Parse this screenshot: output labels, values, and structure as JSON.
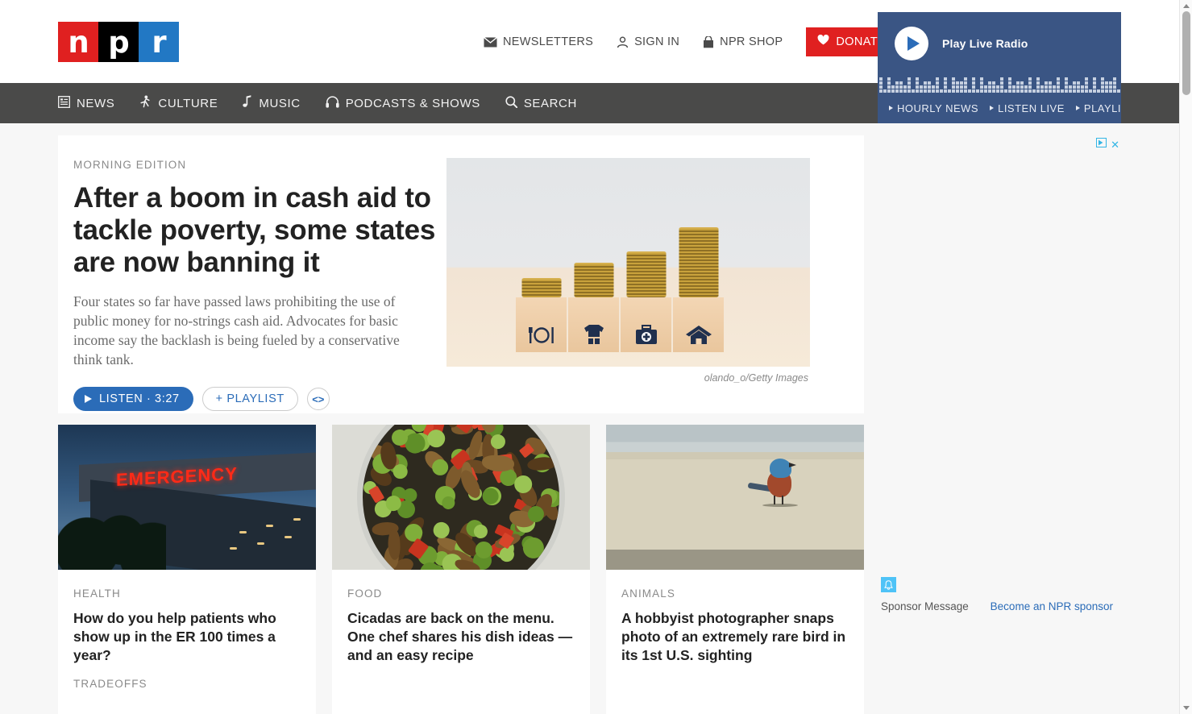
{
  "header": {
    "logo": {
      "letters": [
        "n",
        "p",
        "r"
      ],
      "colors": [
        "#e02020",
        "#000000",
        "#2278c4"
      ]
    },
    "util_nav": [
      {
        "label": "NEWSLETTERS",
        "icon": "envelope-icon"
      },
      {
        "label": "SIGN IN",
        "icon": "person-icon"
      },
      {
        "label": "NPR SHOP",
        "icon": "shopping-bag-icon"
      }
    ],
    "donate_label": "DONATE"
  },
  "mainnav": [
    {
      "label": "NEWS",
      "icon": "list-icon"
    },
    {
      "label": "CULTURE",
      "icon": "dancer-icon"
    },
    {
      "label": "MUSIC",
      "icon": "music-note-icon"
    },
    {
      "label": "PODCASTS & SHOWS",
      "icon": "headphones-icon"
    },
    {
      "label": "SEARCH",
      "icon": "search-icon"
    }
  ],
  "radio": {
    "play_label": "Play Live Radio",
    "links": [
      "HOURLY NEWS",
      "LISTEN LIVE",
      "PLAYLIST"
    ],
    "panel_color": "#3a5584"
  },
  "hero": {
    "kicker": "MORNING EDITION",
    "title": "After a boom in cash aid to tackle poverty, some states are now banning it",
    "teaser": "Four states so far have passed laws prohibiting the use of public money for no-strings cash aid. Advocates for basic income say the backlash is being fueled by a conservative think tank.",
    "listen_label": "LISTEN · 3:27",
    "playlist_label": "+ PLAYLIST",
    "embed_label": "<>",
    "credit": "olando_o/Getty Images",
    "image_alt": "Stacks of coins on wooden blocks with food, clothing, medical and housing icons"
  },
  "cards": [
    {
      "kicker": "HEALTH",
      "title": "How do you help patients who show up in the ER 100 times a year?",
      "source": "TRADEOFFS",
      "image_alt": "Hospital emergency entrance sign glowing red at dusk",
      "sign_text": "EMERGENCY"
    },
    {
      "kicker": "FOOD",
      "title": "Cicadas are back on the menu. One chef shares his dish ideas — and an easy recipe",
      "source": "",
      "image_alt": "Bowl of stir fried cicadas with edamame and red peppers"
    },
    {
      "kicker": "ANIMALS",
      "title": "A hobbyist photographer snaps photo of an extremely rare bird in its 1st U.S. sighting",
      "source": "",
      "image_alt": "Blue and rust colored bird standing on a sandy beach"
    }
  ],
  "ad": {
    "choices_icon": "adchoices-icon",
    "close_label": "✕",
    "sponsor_message": "Sponsor Message",
    "sponsor_link": "Become an NPR sponsor",
    "bell_icon": "bell-icon"
  }
}
